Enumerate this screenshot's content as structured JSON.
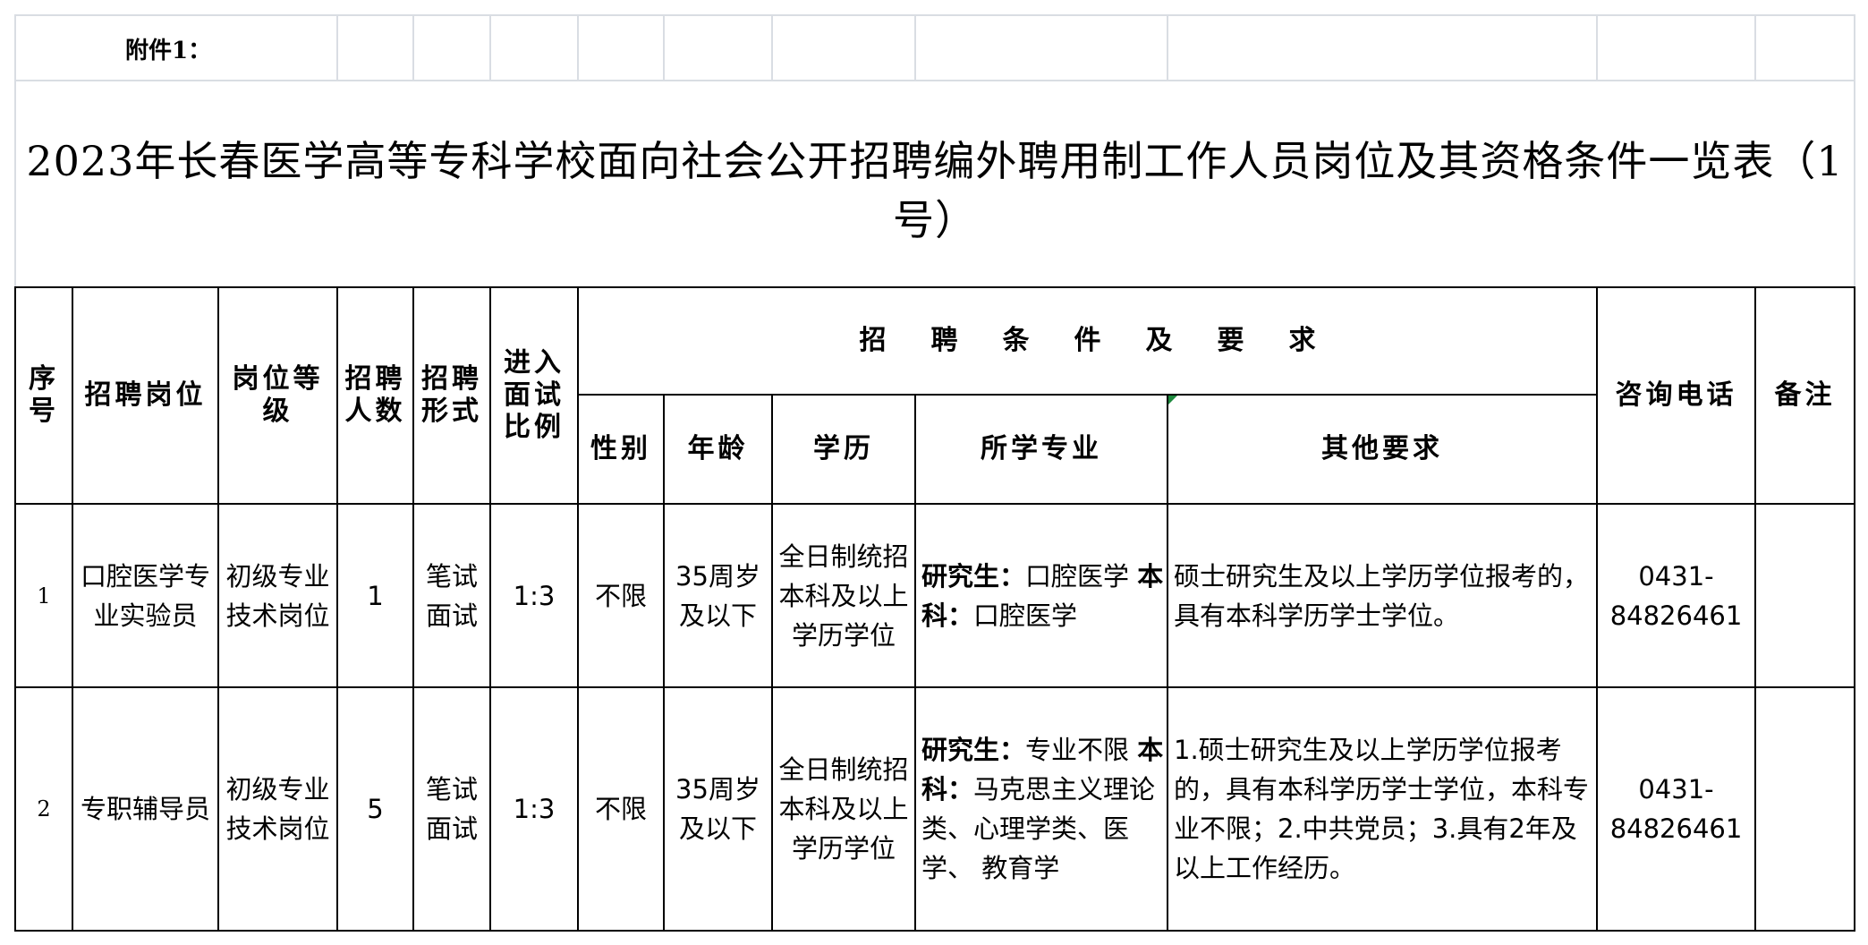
{
  "attachment_label": "附件1：",
  "title": "2023年长春医学高等专科学校面向社会公开招聘编外聘用制工作人员岗位及其资格条件一览表（1号）",
  "headers": {
    "seq": [
      "序",
      "号"
    ],
    "position": "招聘岗位",
    "level": [
      "岗位",
      "等级"
    ],
    "count": [
      "招聘",
      "人数"
    ],
    "form": [
      "招聘",
      "形式"
    ],
    "ratio": [
      "进入",
      "面试",
      "比例"
    ],
    "conditions": "招聘条件及要求",
    "gender": "性别",
    "age": "年龄",
    "education": "学历",
    "major": "所学专业",
    "other": "其他要求",
    "phone": "咨询电话",
    "remark": "备注"
  },
  "rows": [
    {
      "seq": "1",
      "position": [
        "口腔医学专",
        "业实验员"
      ],
      "level": [
        "初级专业",
        "技术岗位"
      ],
      "count": "1",
      "form": [
        "笔试",
        "面试"
      ],
      "ratio": "1:3",
      "gender": "不限",
      "age": [
        "35周岁及",
        "以下"
      ],
      "education": [
        "全日制统招",
        "本科及以上",
        "学历学位"
      ],
      "major": [
        {
          "label": "研究生：",
          "value": "口腔医学"
        },
        {
          "label": "本科：",
          "value": "口腔医学"
        }
      ],
      "other": [
        "硕士研究生及以上学历学位报考的，具有",
        "本科学历学士学位。"
      ],
      "phone": [
        "0431-",
        "84826461"
      ],
      "remark": ""
    },
    {
      "seq": "2",
      "position": [
        "专职辅导员"
      ],
      "level": [
        "初级专业",
        "技术岗位"
      ],
      "count": "5",
      "form": [
        "笔试",
        "面试"
      ],
      "ratio": "1:3",
      "gender": "不限",
      "age": [
        "35周岁及",
        "以下"
      ],
      "education": [
        "全日制统招",
        "本科及以上",
        "学历学位"
      ],
      "major": [
        {
          "label": "研究生：",
          "value": "专业不限"
        },
        {
          "label": "本科：",
          "value": "马克思主义理论"
        },
        {
          "label": "",
          "value": "类、心理学类、医学、"
        },
        {
          "label": "",
          "value": "教育学"
        }
      ],
      "other": [
        "1.硕士研究生及以上学历学位报考的，具",
        "有本科学历学士学位，本科专业不限；",
        "2.中共党员；",
        "3.具有2年及以上工作经历。"
      ],
      "phone": [
        "0431-",
        "84826461"
      ],
      "remark": ""
    }
  ]
}
